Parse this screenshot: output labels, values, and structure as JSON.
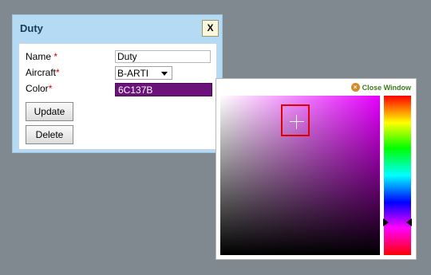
{
  "dialog": {
    "title": "Duty",
    "close_label": "X",
    "fields": {
      "name_label": "Name",
      "aircraft_label": "Aircraft",
      "color_label": "Color",
      "required_mark": "*",
      "name_value": "Duty",
      "aircraft_value": "B-ARTI",
      "color_value": "6C137B"
    },
    "buttons": {
      "update_label": "Update",
      "delete_label": "Delete"
    }
  },
  "color_picker": {
    "close_label": "Close Window",
    "close_icon": "close-circle-icon",
    "selected_color": "#6C137B",
    "hue_color": "#e600ff"
  }
}
